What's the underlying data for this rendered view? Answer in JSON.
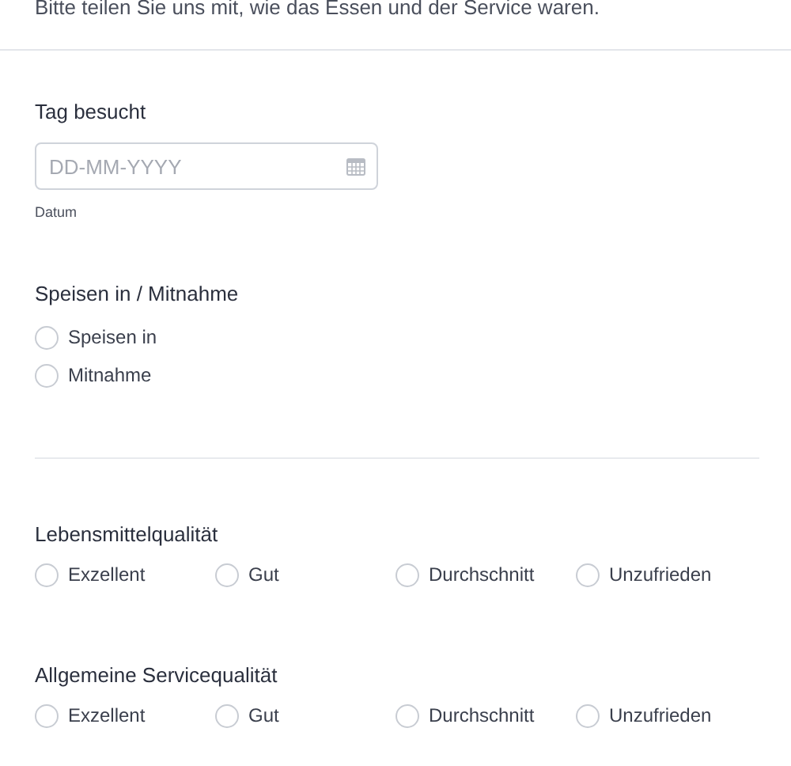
{
  "intro": "Bitte teilen Sie uns mit, wie das Essen und der Service waren.",
  "date_field": {
    "label": "Tag besucht",
    "placeholder": "DD-MM-YYYY",
    "hint": "Datum"
  },
  "dining": {
    "label": "Speisen in / Mitnahme",
    "options": [
      {
        "label": "Speisen in",
        "selected": false
      },
      {
        "label": "Mitnahme",
        "selected": false
      }
    ]
  },
  "ratings": [
    {
      "label": "Lebensmittelqualität",
      "options": [
        {
          "label": "Exzellent",
          "selected": false
        },
        {
          "label": "Gut",
          "selected": false
        },
        {
          "label": "Durchschnitt",
          "selected": false
        },
        {
          "label": "Unzufrieden",
          "selected": false
        }
      ]
    },
    {
      "label": "Allgemeine Servicequalität",
      "options": [
        {
          "label": "Exzellent",
          "selected": false
        },
        {
          "label": "Gut",
          "selected": false
        },
        {
          "label": "Durchschnitt",
          "selected": false
        },
        {
          "label": "Unzufrieden",
          "selected": false
        }
      ]
    }
  ]
}
